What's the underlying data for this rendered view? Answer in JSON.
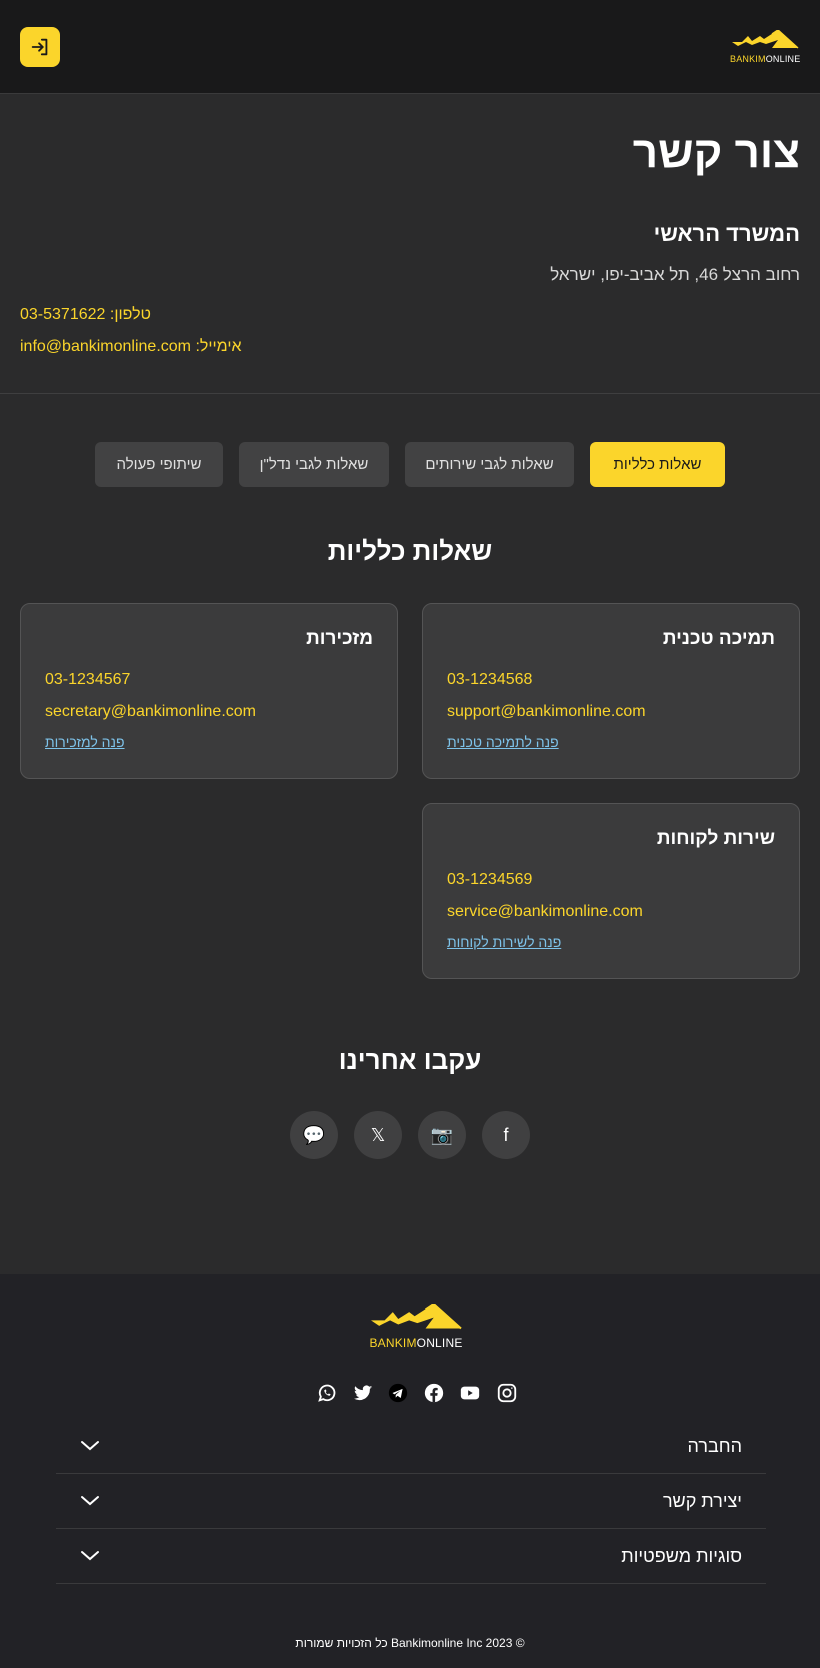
{
  "header": {
    "logo": {
      "brand_yellow": "BANKIM",
      "brand_white": "ONLINE"
    },
    "login_icon": "login-arrow-icon"
  },
  "contact": {
    "title": "צור קשר",
    "office_title": "המשרד הראשי",
    "address": "רחוב הרצל 46, תל אביב-יפו, ישראל",
    "phone": "טלפון: 03-5371622",
    "email": "אימייל: info@bankimonline.com"
  },
  "tabs": [
    {
      "label": "שאלות כלליות",
      "active": true
    },
    {
      "label": "שאלות לגבי שירותים",
      "active": false
    },
    {
      "label": "שאלות לגבי נדל\"ן",
      "active": false
    },
    {
      "label": "שיתופי פעולה",
      "active": false
    }
  ],
  "general": {
    "title": "שאלות כלליות",
    "cards": [
      {
        "title": "תמיכה טכנית",
        "phone": "03-1234568",
        "email": "support@bankimonline.com",
        "link": "פנה לתמיכה טכנית"
      },
      {
        "title": "מזכירות",
        "phone": "03-1234567",
        "email": "secretary@bankimonline.com",
        "link": "פנה למזכירות"
      },
      {
        "title": "שירות לקוחות",
        "phone": "03-1234569",
        "email": "service@bankimonline.com",
        "link": "פנה לשירות לקוחות"
      }
    ]
  },
  "follow": {
    "title": "עקבו אחרינו",
    "icons": [
      {
        "name": "facebook-icon",
        "glyph": "f"
      },
      {
        "name": "camera-icon",
        "glyph": "📷"
      },
      {
        "name": "x-icon",
        "glyph": "𝕏"
      },
      {
        "name": "chat-bubble-icon",
        "glyph": "💬"
      }
    ]
  },
  "footer": {
    "logo": {
      "brand_yellow": "BANKIM",
      "brand_white": "ONLINE"
    },
    "social_icons": [
      "whatsapp-icon",
      "twitter-icon",
      "telegram-icon",
      "facebook-icon",
      "youtube-icon",
      "instagram-icon"
    ],
    "accordion": [
      {
        "label": "החברה"
      },
      {
        "label": "יצירת קשר"
      },
      {
        "label": "סוגיות משפטיות"
      }
    ],
    "copyright": "© Bankimonline Inc 2023 כל הזכויות שמורות"
  },
  "colors": {
    "accent": "#fbd52b",
    "background": "#2b2b2c",
    "header_bg": "#19191a",
    "card_bg": "#3b3b3c",
    "link": "#7ec3ea",
    "footer_bg": "#222226"
  }
}
